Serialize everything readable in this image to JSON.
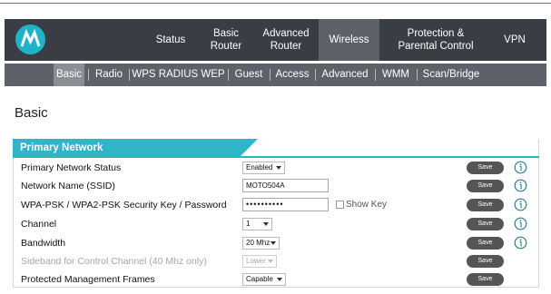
{
  "nav": {
    "items": [
      {
        "label": "Status"
      },
      {
        "label": "Basic\nRouter"
      },
      {
        "label": "Advanced\nRouter"
      },
      {
        "label": "Wireless",
        "active": true
      },
      {
        "label": "Protection &\nParental Control"
      },
      {
        "label": "VPN"
      }
    ]
  },
  "subnav": {
    "items": [
      {
        "label": "Basic",
        "active": true
      },
      {
        "label": "Radio"
      },
      {
        "label": "WPS RADIUS WEP"
      },
      {
        "label": "Guest"
      },
      {
        "label": "Access"
      },
      {
        "label": "Advanced"
      },
      {
        "label": "WMM"
      },
      {
        "label": "Scan/Bridge"
      }
    ]
  },
  "page_title": "Basic",
  "section": {
    "title": "Primary Network",
    "save_label": "Save",
    "rows": [
      {
        "label": "Primary Network Status",
        "control": "select",
        "value": "Enabled"
      },
      {
        "label": "Network Name (SSID)",
        "control": "text",
        "value": "MOTO504A"
      },
      {
        "label": "WPA-PSK / WPA2-PSK Security Key / Password",
        "control": "password",
        "value": "••••••••••",
        "checkbox_label": "Show Key"
      },
      {
        "label": "Channel",
        "control": "select",
        "value": "1"
      },
      {
        "label": "Bandwidth",
        "control": "select",
        "value": "20 Mhz"
      },
      {
        "label": "Sideband for Control Channel (40 Mhz only)",
        "control": "select",
        "value": "Lower",
        "disabled": true
      },
      {
        "label": "Protected Management Frames",
        "control": "select",
        "value": "Capable"
      }
    ]
  },
  "colors": {
    "accent": "#2fb5c7",
    "nav_bg": "#3a3d44",
    "subnav_bg": "#5d626a",
    "save_button": "#555555",
    "info_icon": "#2f7d8f"
  },
  "icons": {
    "logo": "motorola-logo",
    "info": "info-icon"
  }
}
